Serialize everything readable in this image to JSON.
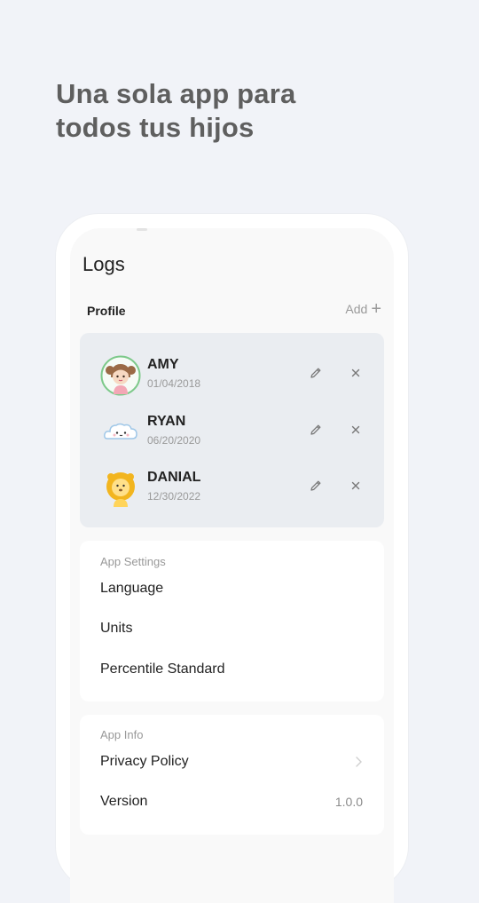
{
  "headline": {
    "line1": "Una sola app para",
    "line2": "todos tus hijos"
  },
  "screen": {
    "title": "Logs",
    "profile": {
      "label": "Profile",
      "add_label": "Add",
      "children": [
        {
          "name": "AMY",
          "date": "01/04/2018",
          "avatar": "girl-avatar"
        },
        {
          "name": "RYAN",
          "date": "06/20/2020",
          "avatar": "cloud-avatar"
        },
        {
          "name": "DANIAL",
          "date": "12/30/2022",
          "avatar": "lion-avatar"
        }
      ]
    },
    "app_settings": {
      "label": "App Settings",
      "items": [
        "Language",
        "Units",
        "Percentile Standard"
      ]
    },
    "app_info": {
      "label": "App Info",
      "privacy": "Privacy Policy",
      "version_label": "Version",
      "version_value": "1.0.0"
    }
  },
  "colors": {
    "background": "#f1f3f8",
    "card": "#eaedf1",
    "selected_ring": "#7dc98a"
  }
}
